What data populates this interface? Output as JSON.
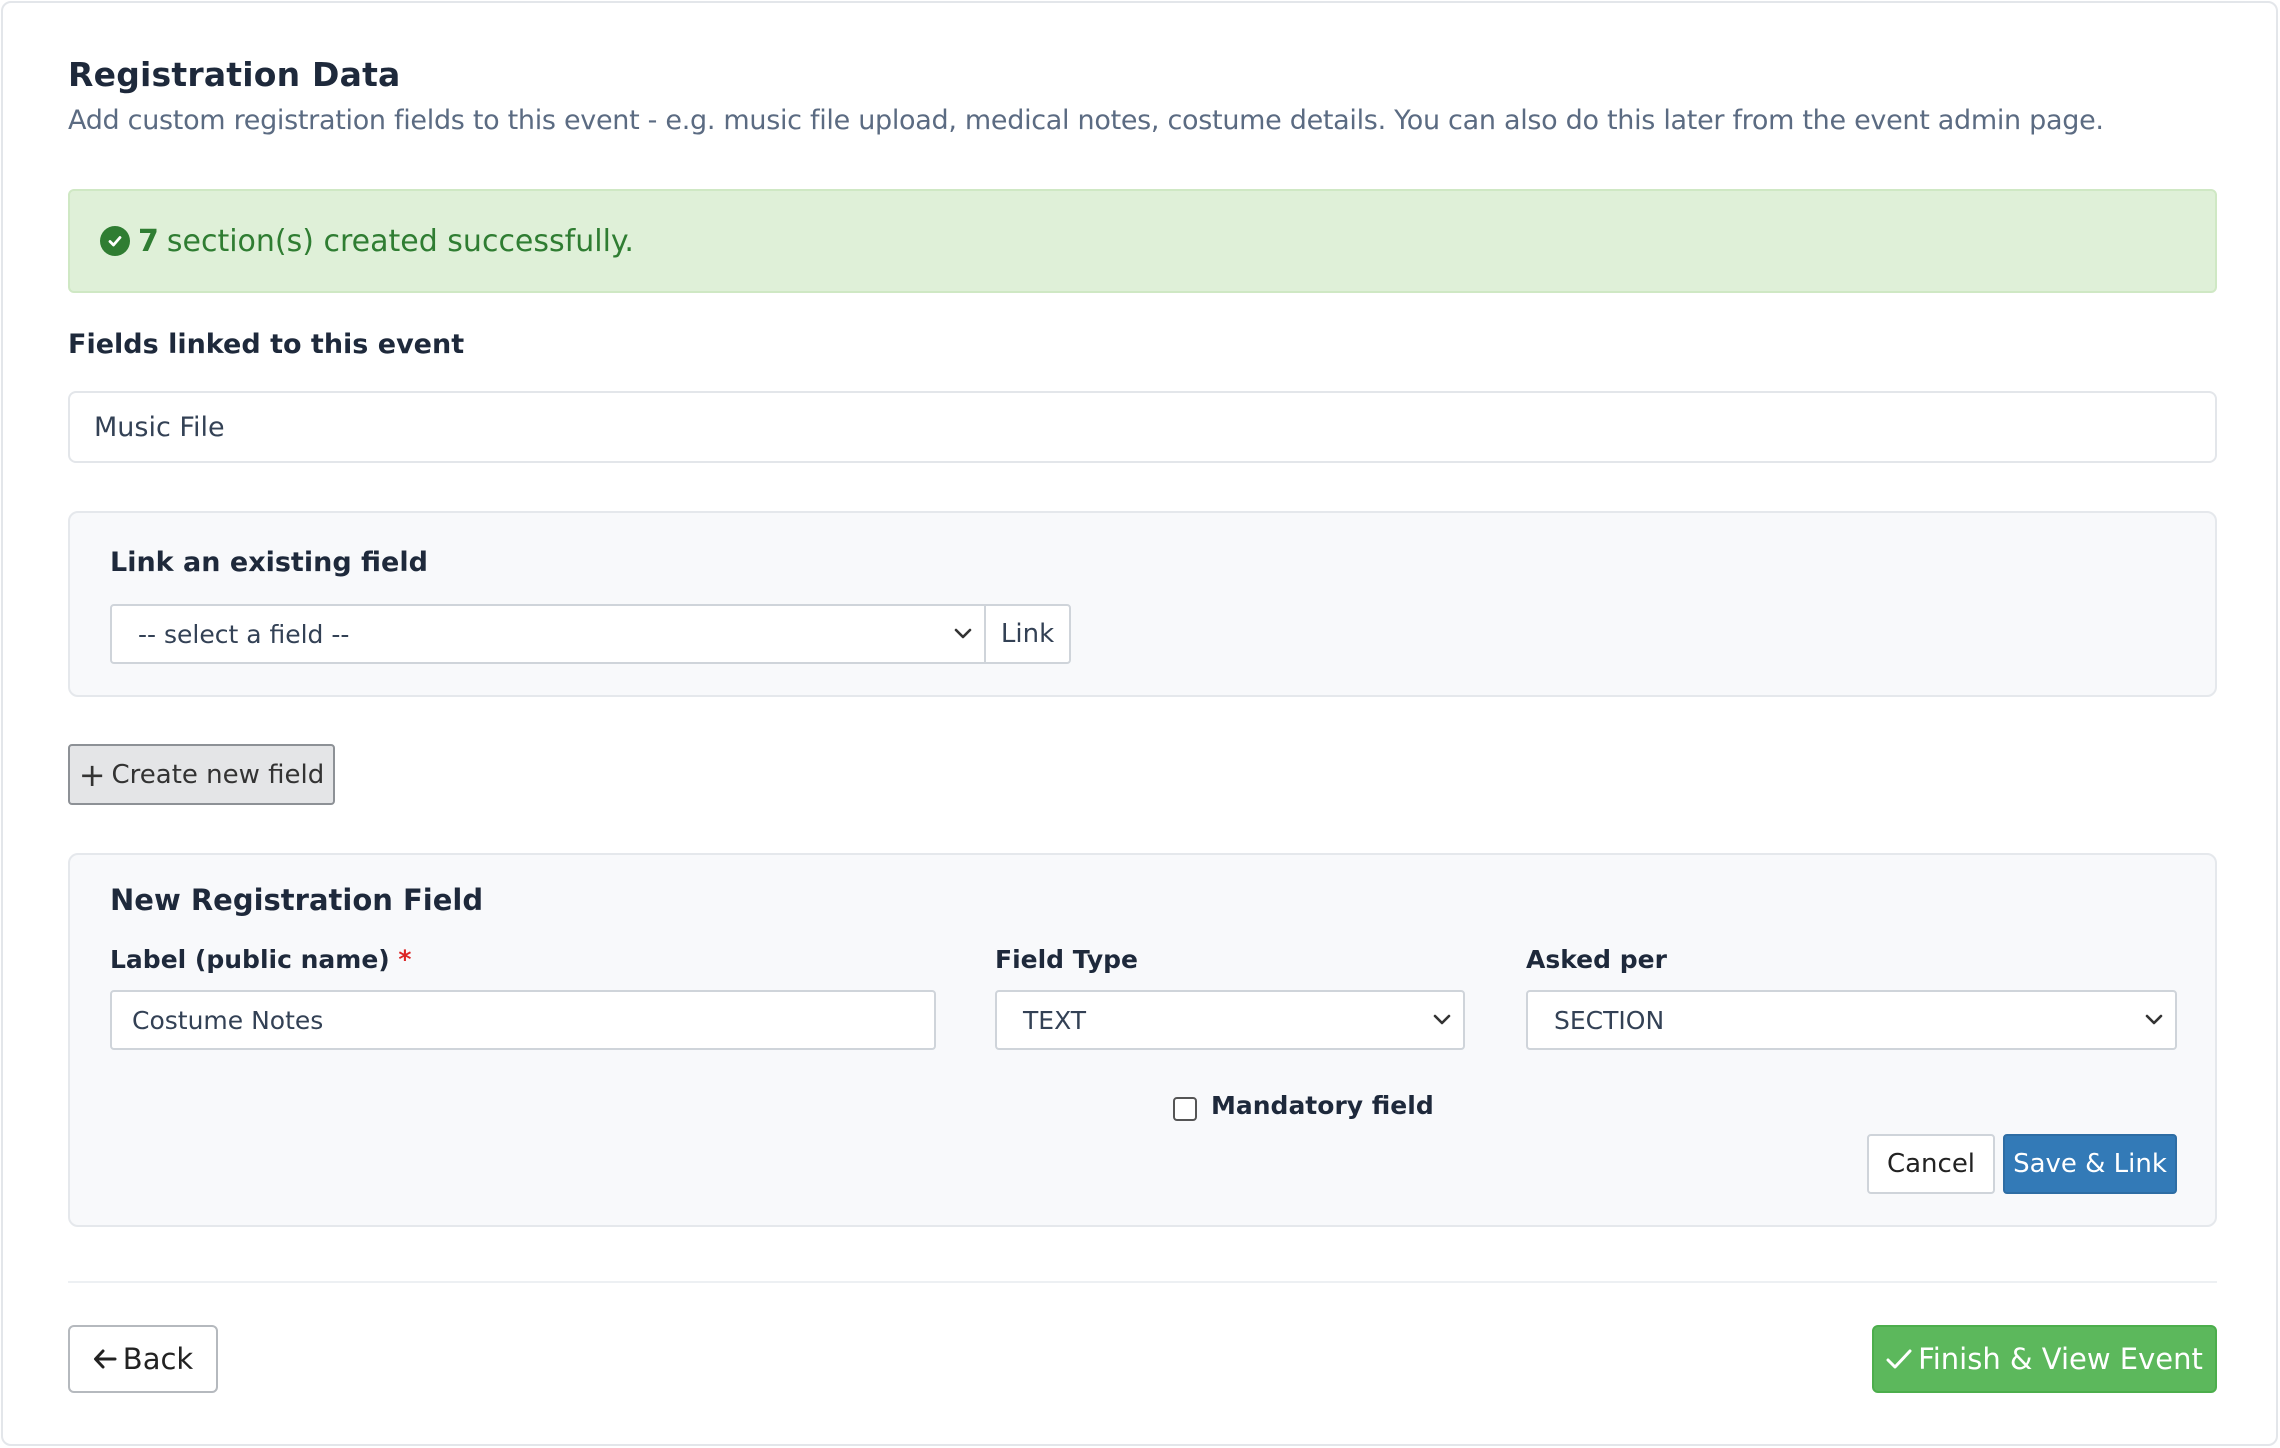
{
  "header": {
    "title": "Registration Data",
    "subtitle": "Add custom registration fields to this event - e.g. music file upload, medical notes, costume details. You can also do this later from the event admin page."
  },
  "alert": {
    "count": "7",
    "message": "section(s) created successfully.",
    "icon": "check-circle-icon",
    "color": "#2f7d32",
    "background": "#dff0d8"
  },
  "linked": {
    "heading": "Fields linked to this event",
    "fields": [
      "Music File"
    ]
  },
  "link_existing": {
    "heading": "Link an existing field",
    "select_value": "-- select a field --",
    "link_label": "Link"
  },
  "create_button": {
    "label": "Create new field",
    "icon": "plus-icon"
  },
  "new_field": {
    "heading": "New Registration Field",
    "label_field": {
      "label": "Label (public name)",
      "required_marker": "*",
      "value": "Costume Notes"
    },
    "field_type": {
      "label": "Field Type",
      "value": "TEXT"
    },
    "asked_per": {
      "label": "Asked per",
      "value": "SECTION"
    },
    "mandatory": {
      "label": "Mandatory field",
      "checked": false
    },
    "cancel_label": "Cancel",
    "save_label": "Save & Link"
  },
  "footer": {
    "back_label": "Back",
    "finish_label": "Finish & View Event",
    "finish_color": "#5cb85c",
    "save_color": "#337ab7"
  }
}
